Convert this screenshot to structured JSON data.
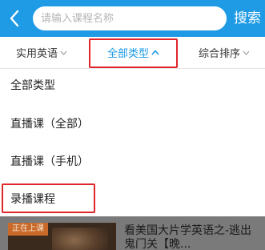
{
  "header": {
    "back_icon": "chevron-left-icon",
    "search_placeholder": "请输入课程名称",
    "search_button_label": "搜索",
    "background_color": "#1f9be6"
  },
  "filters": {
    "items": [
      {
        "label": "实用英语",
        "icon": "chevron-down-icon",
        "active": false
      },
      {
        "label": "全部类型",
        "icon": "chevron-up-icon",
        "active": true
      },
      {
        "label": "综合排序",
        "icon": "chevron-down-icon",
        "active": false
      }
    ],
    "active_color": "#1f9be6",
    "highlight_color": "#e0262b"
  },
  "dropdown": {
    "options": [
      {
        "label": "全部类型"
      },
      {
        "label": "直播课（全部）"
      },
      {
        "label": "直播课（手机）"
      },
      {
        "label": "录播课程",
        "highlighted": true
      }
    ]
  },
  "course_list": {
    "items": [
      {
        "badge": "正在上课",
        "title": "看美国大片学英语之-逃出鬼门关【晚..."
      }
    ]
  }
}
